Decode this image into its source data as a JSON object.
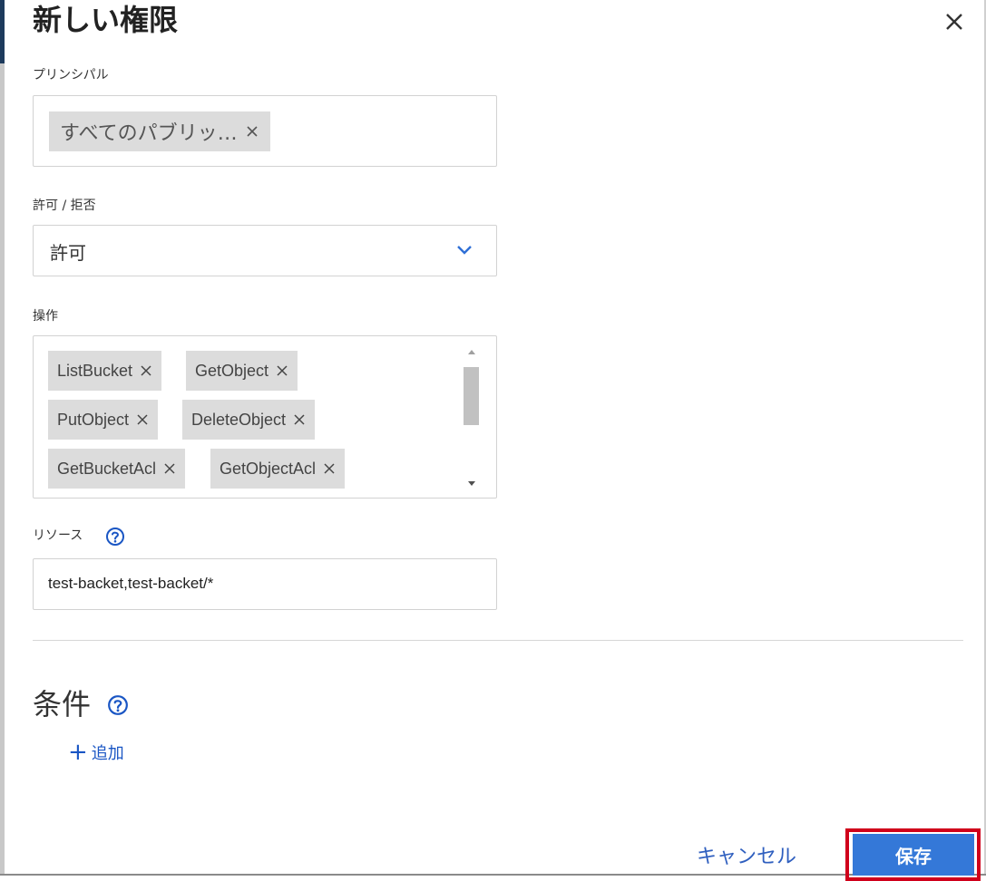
{
  "dialog": {
    "title": "新しい権限",
    "close_icon": "close-icon"
  },
  "principal": {
    "label": "プリンシパル",
    "chip": "すべてのパブリッ…"
  },
  "effect": {
    "label": "許可 / 拒否",
    "value": "許可"
  },
  "operations": {
    "label": "操作",
    "chips": [
      "ListBucket",
      "GetObject",
      "PutObject",
      "DeleteObject",
      "GetBucketAcl",
      "GetObjectAcl"
    ]
  },
  "resources": {
    "label": "リソース",
    "value": "test-backet,test-backet/*"
  },
  "conditions": {
    "title": "条件",
    "add_label": "追加"
  },
  "footer": {
    "cancel_label": "キャンセル",
    "save_label": "保存"
  },
  "colors": {
    "accent": "#3478d8",
    "link": "#1a56c4",
    "highlight": "#d0001b"
  }
}
